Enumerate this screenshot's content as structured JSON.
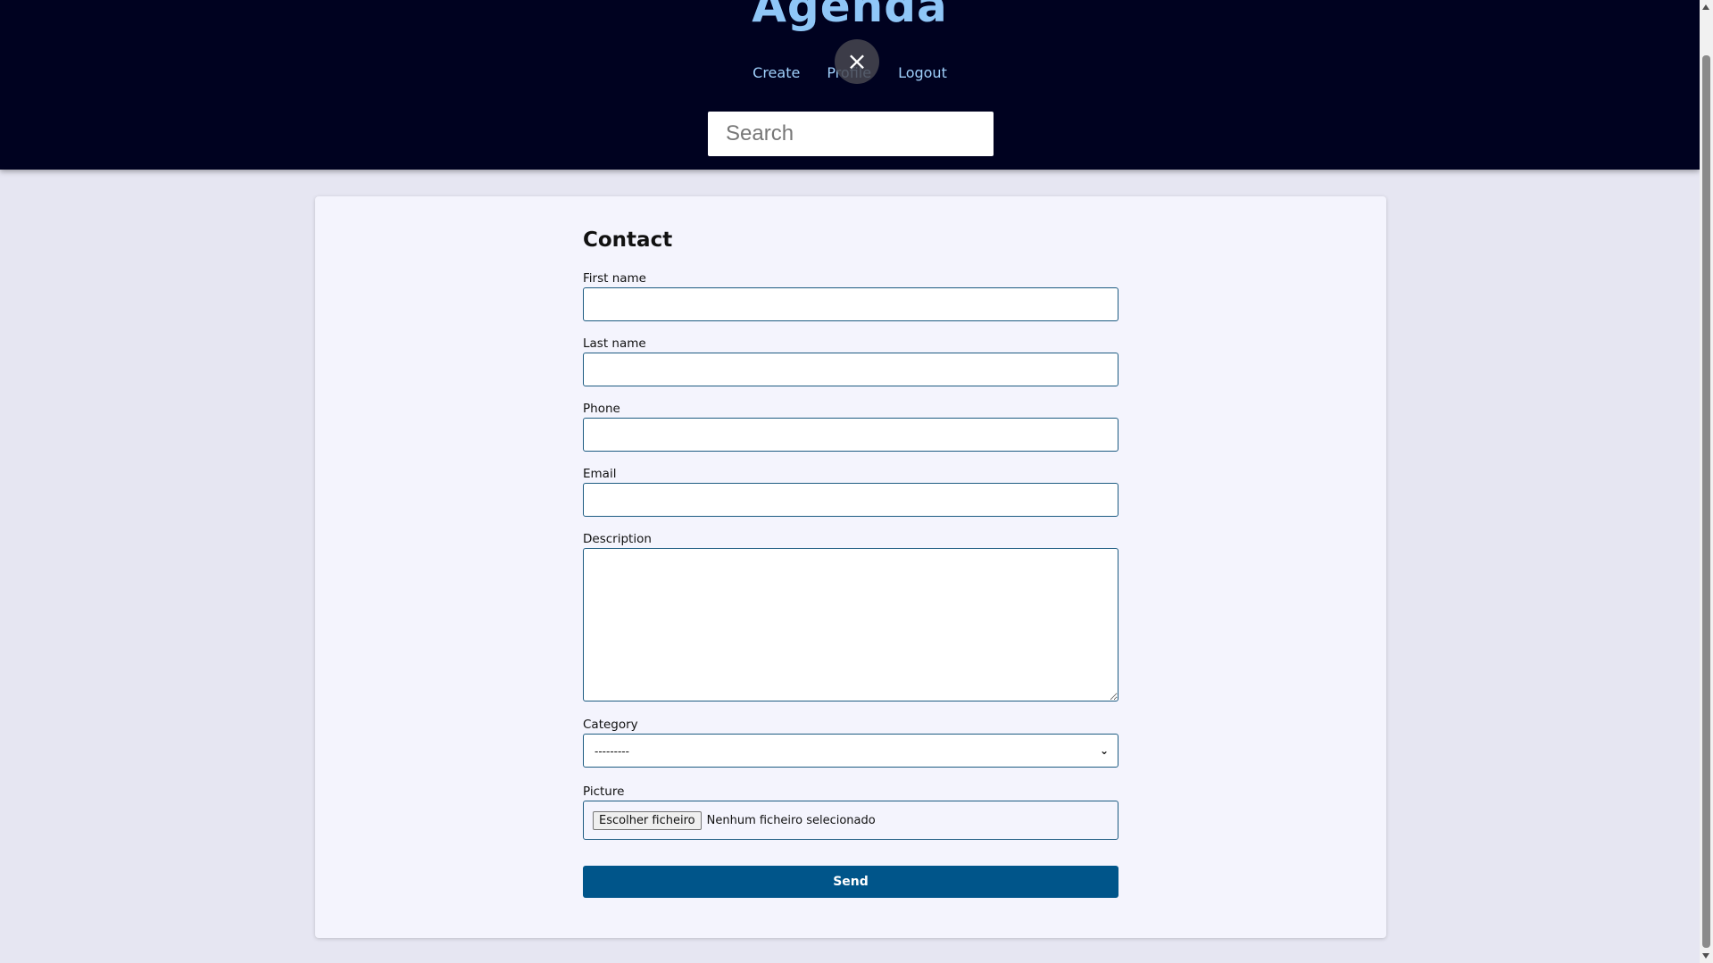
{
  "header": {
    "brand": "Agenda",
    "nav": [
      "Create",
      "Profile",
      "Logout"
    ],
    "close_icon": "×",
    "search": {
      "placeholder": "Search",
      "value": ""
    }
  },
  "form": {
    "title": "Contact",
    "first_name_label": "First name",
    "last_name_label": "Last name",
    "phone_label": "Phone",
    "email_label": "Email",
    "description_label": "Description",
    "category_label": "Category",
    "category_value": "---------",
    "picture_label": "Picture",
    "file_button": "Escolher ficheiro",
    "file_status": "Nenhum ficheiro selecionado",
    "send_label": "Send"
  },
  "colors": {
    "header_bg": "#000220",
    "brand": "#8fc6f7",
    "nav_link": "#9fd0fb",
    "page_bg": "#e6e6f2",
    "card_bg": "#f4f4fd",
    "input_border": "#1d5b82",
    "send_bg": "#00558a"
  }
}
